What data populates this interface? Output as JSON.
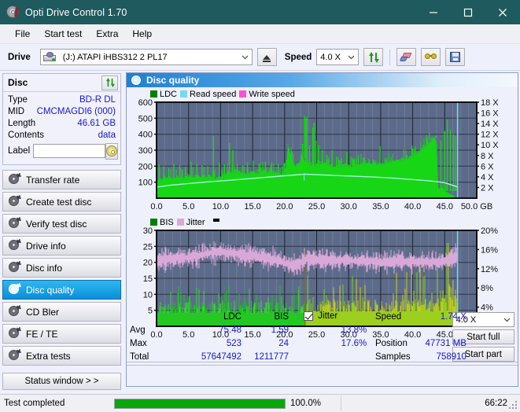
{
  "window": {
    "title": "Opti Drive Control 1.70",
    "app_icon": "disc-icon",
    "minimize": "─",
    "maximize": "□",
    "close": "✕"
  },
  "menu": {
    "items": [
      "File",
      "Start test",
      "Extra",
      "Help"
    ]
  },
  "toolbar": {
    "drive_label": "Drive",
    "drive_value": "(J:)   ATAPI iHBS312  2 PL17",
    "eject_title": "eject",
    "speed_label": "Speed",
    "speed_value": "4.0 X",
    "refresh_title": "refresh",
    "erase_title": "erase",
    "glasses_title": "scan",
    "save_title": "save"
  },
  "disc": {
    "group_title": "Disc",
    "refresh_title": "refresh-disc",
    "rows": [
      {
        "key": "Type",
        "value": "BD-R DL"
      },
      {
        "key": "MID",
        "value": "CMCMAGDI6 (000)"
      },
      {
        "key": "Length",
        "value": "46.61 GB"
      },
      {
        "key": "Contents",
        "value": "data"
      }
    ],
    "label_key": "Label",
    "label_value": "",
    "label_placeholder": ""
  },
  "nav": {
    "items": [
      {
        "label": "Transfer rate",
        "selected": false
      },
      {
        "label": "Create test disc",
        "selected": false
      },
      {
        "label": "Verify test disc",
        "selected": false
      },
      {
        "label": "Drive info",
        "selected": false
      },
      {
        "label": "Disc info",
        "selected": false
      },
      {
        "label": "Disc quality",
        "selected": true
      },
      {
        "label": "CD Bler",
        "selected": false
      },
      {
        "label": "FE / TE",
        "selected": false
      },
      {
        "label": "Extra tests",
        "selected": false
      }
    ],
    "status_window": "Status window > >"
  },
  "panel": {
    "title": "Disc quality",
    "icon": "disc-quality-icon"
  },
  "stats": {
    "col_headers": [
      "LDC",
      "BIS"
    ],
    "row_labels": [
      "Avg",
      "Max",
      "Total"
    ],
    "ldc": {
      "avg": "75.48",
      "max": "523",
      "total": "57647492"
    },
    "bis": {
      "avg": "1.59",
      "max": "24",
      "total": "1211777"
    },
    "jitter": {
      "label": "Jitter",
      "checked": true,
      "avg": "13.8%",
      "max": "17.6%"
    },
    "speed_label": "Speed",
    "speed_value": "1.74 X",
    "position_label": "Position",
    "position_value": "47731 MB",
    "samples_label": "Samples",
    "samples_value": "758910",
    "speed_select": "4.0 X",
    "start_full": "Start full",
    "start_part": "Start part"
  },
  "statusbar": {
    "message": "Test completed",
    "percent_text": "100.0%",
    "percent_value": 100,
    "time": "66:22"
  },
  "colors": {
    "titlebar": "#1e5a5e",
    "accent_blue": "#1818d0",
    "plot_bg": "#5d6b8a",
    "ldc_green": "#16d616",
    "bis_green": "#3bd53b",
    "jitter_pink": "#d9a8d9",
    "read_speed": "#79d7f2",
    "write_speed": "#ff4fd8",
    "yellow": "#c8c81e",
    "progress": "#0aa60a",
    "selected_nav": "#0a8fd8"
  },
  "chart_data": [
    {
      "type": "area",
      "name": "LDC / Read speed",
      "title": "Disc quality",
      "legend": [
        {
          "label": "LDC",
          "color": "#007f00"
        },
        {
          "label": "Read speed",
          "color": "#79d7f2"
        },
        {
          "label": "Write speed",
          "color": "#ff4fd8"
        }
      ],
      "legend_position": "top-left",
      "xlabel": "GB",
      "x_ticks": [
        "0.0",
        "5.0",
        "10.0",
        "15.0",
        "20.0",
        "25.0",
        "30.0",
        "35.0",
        "40.0",
        "45.0",
        "50.0 GB"
      ],
      "xlim": [
        0,
        50
      ],
      "ylabel_left": "LDC",
      "y_ticks_left": [
        "100",
        "200",
        "300",
        "400",
        "500",
        "600"
      ],
      "ylim_left": [
        0,
        600
      ],
      "ylabel_right": "Speed",
      "y_ticks_right": [
        "2 X",
        "4 X",
        "6 X",
        "8 X",
        "10 X",
        "12 X",
        "14 X",
        "16 X",
        "18 X"
      ],
      "ylim_right": [
        0,
        18
      ],
      "grid": true,
      "data_end_gb": 47.0,
      "series": [
        {
          "name": "LDC",
          "color": "#16d616",
          "kind": "area-spikes",
          "x_step_gb": 0.25,
          "baseline": [
            95,
            110,
            118,
            112,
            120,
            128,
            122,
            118,
            126,
            130,
            120,
            118,
            124,
            128,
            120,
            116,
            118,
            122,
            126,
            130,
            134,
            128,
            124,
            126,
            130,
            136,
            134,
            130,
            128,
            132,
            128,
            126,
            130,
            128,
            124,
            122,
            118,
            116,
            120,
            124,
            128,
            132,
            136,
            140,
            150,
            155,
            152,
            148,
            150,
            154,
            158,
            160,
            156,
            152,
            150,
            148,
            146,
            150,
            152,
            156,
            160,
            158,
            154,
            150,
            152,
            156,
            160,
            164,
            160,
            156,
            152,
            150,
            154,
            158,
            160,
            156,
            150,
            148,
            146,
            150,
            160,
            200,
            330,
            300,
            260,
            230,
            210,
            200,
            205,
            215,
            225,
            235,
            245,
            230,
            220,
            215,
            210,
            205,
            200,
            198,
            200,
            205,
            210,
            215,
            218,
            214,
            210,
            206,
            202,
            200,
            198,
            196,
            195,
            194,
            196,
            198,
            200,
            202,
            200,
            198,
            196,
            195,
            198,
            200,
            202,
            204,
            206,
            208,
            210,
            212,
            214,
            216,
            214,
            212,
            210,
            208,
            206,
            205,
            204,
            206,
            208,
            210,
            212,
            214,
            216,
            218,
            220,
            222,
            224,
            226,
            228,
            230,
            232,
            234,
            236,
            238,
            240,
            244,
            250,
            256,
            262,
            268,
            274,
            280,
            288,
            296,
            304,
            312,
            320,
            330,
            340,
            350,
            360,
            370,
            380,
            330,
            60,
            55,
            50,
            48,
            46
          ],
          "spikes": [
            {
              "gb": 0.4,
              "v": 210
            },
            {
              "gb": 1.1,
              "v": 200
            },
            {
              "gb": 1.9,
              "v": 190
            },
            {
              "gb": 2.7,
              "v": 215
            },
            {
              "gb": 3.6,
              "v": 205
            },
            {
              "gb": 4.5,
              "v": 195
            },
            {
              "gb": 5.4,
              "v": 230
            },
            {
              "gb": 6.3,
              "v": 215
            },
            {
              "gb": 7.1,
              "v": 205
            },
            {
              "gb": 8.0,
              "v": 200
            },
            {
              "gb": 8.9,
              "v": 390
            },
            {
              "gb": 9.8,
              "v": 220
            },
            {
              "gb": 10.6,
              "v": 210
            },
            {
              "gb": 11.4,
              "v": 345
            },
            {
              "gb": 11.9,
              "v": 300
            },
            {
              "gb": 12.6,
              "v": 215
            },
            {
              "gb": 13.4,
              "v": 205
            },
            {
              "gb": 14.2,
              "v": 225
            },
            {
              "gb": 15.1,
              "v": 235
            },
            {
              "gb": 16.0,
              "v": 215
            },
            {
              "gb": 17.0,
              "v": 230
            },
            {
              "gb": 18.0,
              "v": 225
            },
            {
              "gb": 19.0,
              "v": 215
            },
            {
              "gb": 20.0,
              "v": 220
            },
            {
              "gb": 21.0,
              "v": 200
            },
            {
              "gb": 22.0,
              "v": 215
            },
            {
              "gb": 22.8,
              "v": 340
            },
            {
              "gb": 23.1,
              "v": 515
            },
            {
              "gb": 23.3,
              "v": 500
            },
            {
              "gb": 23.5,
              "v": 510
            },
            {
              "gb": 23.9,
              "v": 330
            },
            {
              "gb": 24.4,
              "v": 440
            },
            {
              "gb": 24.6,
              "v": 470
            },
            {
              "gb": 24.9,
              "v": 360
            },
            {
              "gb": 25.3,
              "v": 330
            },
            {
              "gb": 25.9,
              "v": 300
            },
            {
              "gb": 26.6,
              "v": 270
            },
            {
              "gb": 27.4,
              "v": 300
            },
            {
              "gb": 28.1,
              "v": 260
            },
            {
              "gb": 28.9,
              "v": 250
            },
            {
              "gb": 29.7,
              "v": 290
            },
            {
              "gb": 30.6,
              "v": 250
            },
            {
              "gb": 31.5,
              "v": 265
            },
            {
              "gb": 32.3,
              "v": 255
            },
            {
              "gb": 33.2,
              "v": 245
            },
            {
              "gb": 34.0,
              "v": 240
            },
            {
              "gb": 34.9,
              "v": 325
            },
            {
              "gb": 35.7,
              "v": 250
            },
            {
              "gb": 36.6,
              "v": 245
            },
            {
              "gb": 37.4,
              "v": 235
            },
            {
              "gb": 38.3,
              "v": 255
            },
            {
              "gb": 39.1,
              "v": 270
            },
            {
              "gb": 39.9,
              "v": 330
            },
            {
              "gb": 40.4,
              "v": 300
            },
            {
              "gb": 41.2,
              "v": 280
            },
            {
              "gb": 42.1,
              "v": 300
            },
            {
              "gb": 42.9,
              "v": 290
            },
            {
              "gb": 43.7,
              "v": 320
            },
            {
              "gb": 44.4,
              "v": 360
            },
            {
              "gb": 45.0,
              "v": 420
            },
            {
              "gb": 45.4,
              "v": 490
            },
            {
              "gb": 45.9,
              "v": 430
            },
            {
              "gb": 46.4,
              "v": 400
            },
            {
              "gb": 46.7,
              "v": 390
            }
          ]
        },
        {
          "name": "Read speed",
          "color": "#a8f0e0",
          "kind": "line",
          "points_x": [
            0,
            2,
            5,
            8,
            11,
            14,
            17,
            20,
            22.8,
            23.1,
            25,
            28,
            31,
            34,
            37,
            40,
            43,
            45,
            47
          ],
          "points_y_x": [
            2.05,
            2.4,
            2.75,
            3.05,
            3.3,
            3.6,
            3.9,
            4.2,
            4.45,
            4.5,
            4.4,
            4.25,
            4.1,
            3.95,
            3.75,
            3.5,
            3.2,
            2.9,
            2.1
          ]
        },
        {
          "name": "Read speed marker",
          "color": "#79d7f2",
          "kind": "vline",
          "gb": 47.0,
          "top": 600
        }
      ]
    },
    {
      "type": "area",
      "name": "BIS / Jitter",
      "legend": [
        {
          "label": "BIS",
          "color": "#007f00"
        },
        {
          "label": "Jitter",
          "color": "#d9a8d9"
        }
      ],
      "legend_position": "top-left",
      "xlabel": "GB",
      "x_ticks": [
        "0.0",
        "5.0",
        "10.0",
        "15.0",
        "20.0",
        "25.0",
        "30.0",
        "35.0",
        "40.0",
        "45.0",
        "50.0 GB"
      ],
      "xlim": [
        0,
        50
      ],
      "ylabel_left": "BIS",
      "y_ticks_left": [
        "5",
        "10",
        "15",
        "20",
        "25",
        "30"
      ],
      "ylim_left": [
        0,
        30
      ],
      "ylabel_right": "Jitter",
      "y_ticks_right": [
        "4%",
        "8%",
        "12%",
        "16%",
        "20%"
      ],
      "ylim_right": [
        0,
        20
      ],
      "grid": true,
      "data_end_gb": 47.0,
      "series": [
        {
          "name": "BIS",
          "color": "#3bd53b",
          "color_alt": "#c8c81e",
          "alt_start_gb": 23.2,
          "kind": "area-spikes",
          "baseline_before": 5.5,
          "baseline_after": 6.0,
          "spike_max_before": 13,
          "spike_max_after": 17
        },
        {
          "name": "Jitter",
          "color": "#d9a8d9",
          "kind": "band",
          "percent_points_x": [
            0,
            2,
            5,
            8,
            10,
            12,
            14,
            16,
            18,
            20,
            22,
            23.2,
            25,
            28,
            31,
            34,
            37,
            40,
            43,
            45,
            46.5
          ],
          "percent_points_y": [
            13.5,
            14.0,
            14.3,
            15.2,
            15.5,
            15.4,
            14.8,
            14.6,
            14.1,
            13.3,
            12.5,
            13.9,
            13.9,
            13.8,
            13.6,
            13.5,
            13.4,
            13.5,
            13.4,
            13.6,
            14.5
          ],
          "noise": 1.6
        }
      ]
    }
  ]
}
